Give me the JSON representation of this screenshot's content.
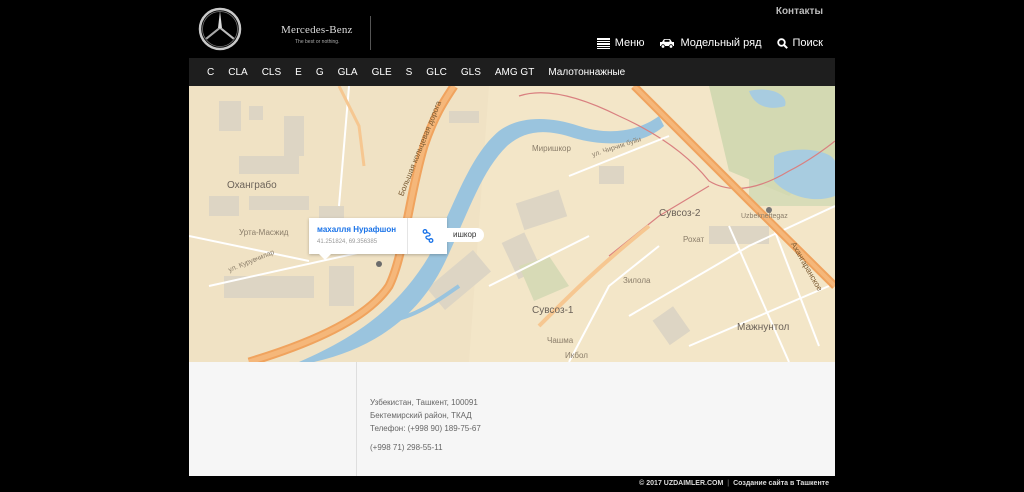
{
  "header": {
    "brand_name": "Mercedes-Benz",
    "brand_tagline": "The best or nothing.",
    "contacts_label": "Контакты",
    "menu_label": "Меню",
    "models_label": "Модельный ряд",
    "search_label": "Поиск"
  },
  "models": [
    "C",
    "CLA",
    "CLS",
    "E",
    "G",
    "GLA",
    "GLE",
    "S",
    "GLC",
    "GLS",
    "AMG GT",
    "Малотоннажные"
  ],
  "map": {
    "labels": {
      "okhangrabo": "Оханграбо",
      "mirishkor": "Миришкор",
      "suvsoz1": "Сувсоз-1",
      "suvsoz2": "Сувсоз-2",
      "majnuntol": "Мажнунтол",
      "zilola": "Зилола",
      "rohat": "Рохат",
      "urta_masjid": "Урта-Масжид",
      "chashma": "Чашма",
      "ikbol": "Икбол",
      "uzbekneftegaz": "Uzbekneftegaz",
      "chirchik": "ул. Чирчик буйи",
      "kuruvchilar": "ул. Курувчилар",
      "ring_road": "Большая кольцевая дорога",
      "akhangaran": "Ахангаранское"
    },
    "popup": {
      "title": "махалля Нурафшон",
      "coords": "41.251824, 69.356385"
    },
    "chip_label": "ишкор"
  },
  "address": {
    "line1": "Узбекистан, Ташкент, 100091",
    "line2": "Бектемирский район, ТКАД",
    "phone1": "Телефон: (+998 90) 189-75-67",
    "phone2": "(+998 71) 298-55-11"
  },
  "footer": {
    "copyright": "© 2017 UZDAIMLER.COM",
    "separator": "|",
    "credit": "Создание сайта в Ташкенте"
  }
}
